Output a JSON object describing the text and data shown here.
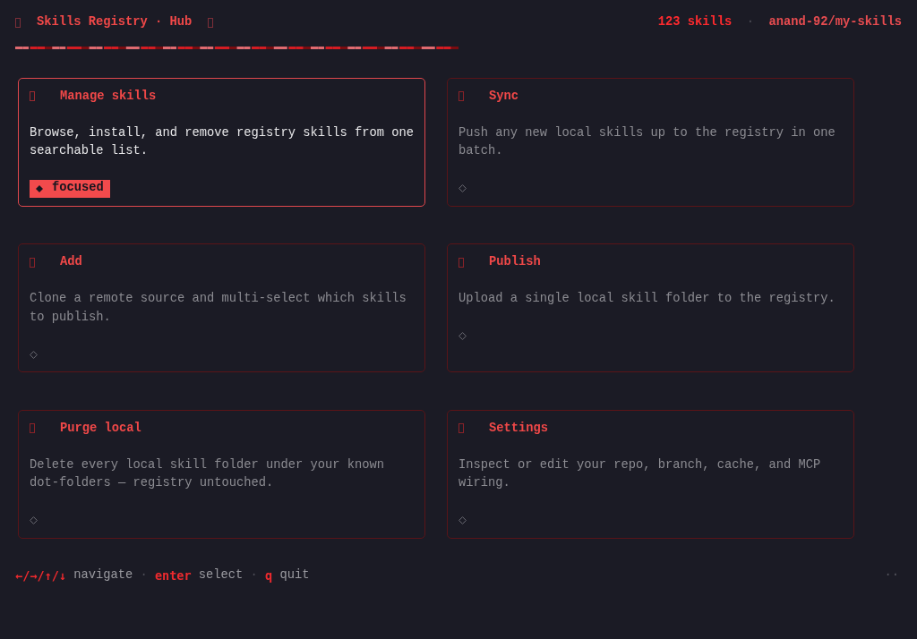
{
  "header": {
    "title": "Skills Registry · Hub",
    "skill_count": "123 skills",
    "separator": "·",
    "repo": "anand-92/my-skills"
  },
  "cards": [
    {
      "title": "Manage skills",
      "description": "Browse, install, and remove registry skills from one searchable list.",
      "selected": true,
      "status": "focused"
    },
    {
      "title": "Sync",
      "description": "Push any new local skills up to the registry in one batch.",
      "selected": false
    },
    {
      "title": "Add",
      "description": "Clone a remote source and multi-select which skills to publish.",
      "selected": false
    },
    {
      "title": "Publish",
      "description": "Upload a single local skill folder to the registry.",
      "selected": false
    },
    {
      "title": "Purge local",
      "description": "Delete every local skill folder under your known dot-folders — registry untouched.",
      "selected": false
    },
    {
      "title": "Settings",
      "description": "Inspect or edit your repo, branch, cache, and MCP wiring.",
      "selected": false
    }
  ],
  "footer": {
    "hints": [
      {
        "kind": "key",
        "text": "←/→/↑/↓"
      },
      {
        "kind": "label",
        "text": "navigate"
      },
      {
        "kind": "separator",
        "text": "·"
      },
      {
        "kind": "key",
        "text": "enter"
      },
      {
        "kind": "label",
        "text": "select"
      },
      {
        "kind": "separator",
        "text": "·"
      },
      {
        "kind": "key",
        "text": "q"
      },
      {
        "kind": "label",
        "text": "quit"
      }
    ],
    "indicator": "··"
  }
}
